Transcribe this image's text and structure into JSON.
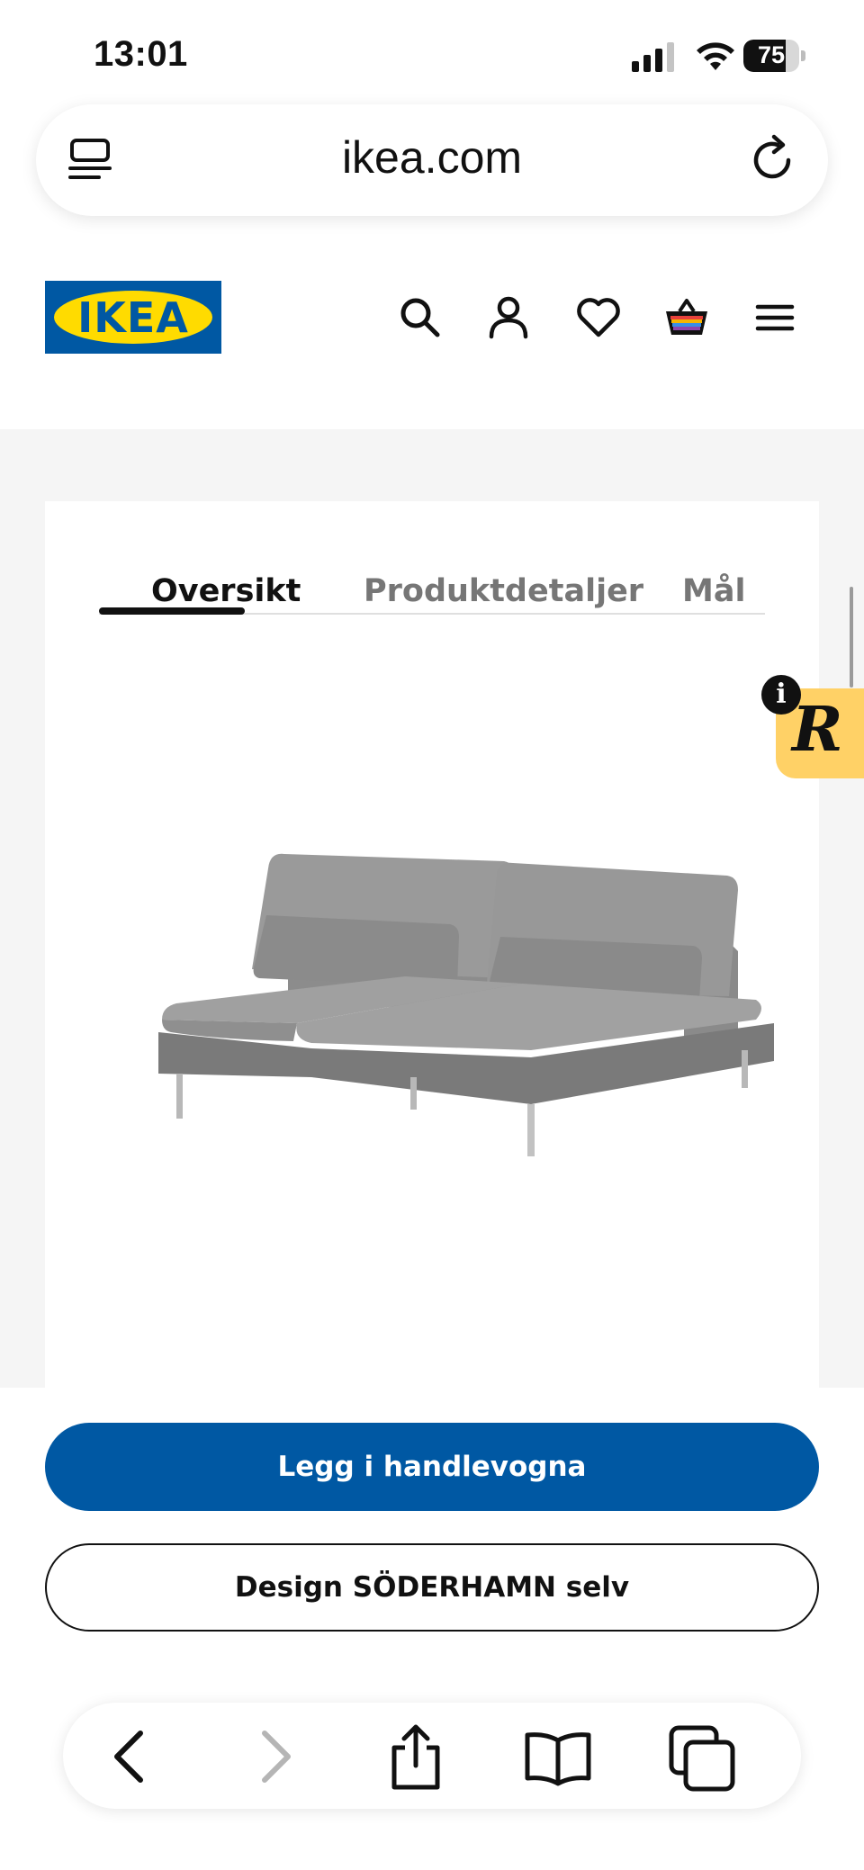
{
  "status_bar": {
    "time": "13:01",
    "battery_percent": "75",
    "battery_level": 0.75
  },
  "browser": {
    "url": "ikea.com",
    "left_icon": "tab-overview-icon",
    "right_icon": "reload-icon"
  },
  "header": {
    "logo_text": "IKEA",
    "brand_colors": {
      "blue": "#0058a3",
      "yellow": "#ffdb00"
    },
    "icons": [
      "search-icon",
      "account-icon",
      "favorites-heart-icon",
      "shopping-basket-icon",
      "menu-icon"
    ]
  },
  "product_section": {
    "tabs": [
      {
        "label": "Oversikt",
        "active": true
      },
      {
        "label": "Produktdetaljer",
        "active": false
      },
      {
        "label": "Mål",
        "active": false
      }
    ],
    "image": "grey-sofa-section-image"
  },
  "badge": {
    "letter": "R",
    "info_letter": "i",
    "color": "#ffd166"
  },
  "actions": {
    "primary_label": "Legg i handlevogna",
    "secondary_label": "Design SÖDERHAMN selv",
    "primary_color": "#0058a3"
  },
  "browser_toolbar": {
    "icons": [
      "back-icon",
      "forward-icon",
      "share-icon",
      "bookmarks-icon",
      "tabs-icon"
    ]
  }
}
